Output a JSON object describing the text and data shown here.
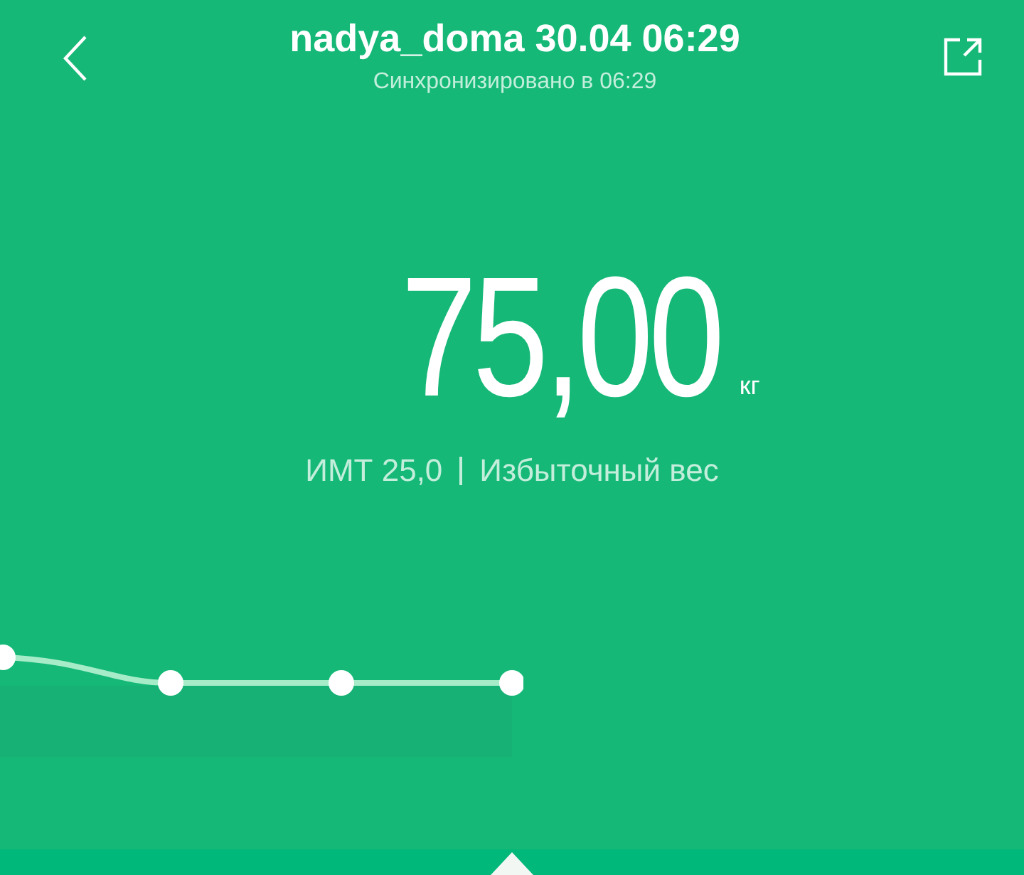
{
  "header": {
    "title": "nadya_doma 30.04 06:29",
    "subtitle": "Синхронизировано в 06:29"
  },
  "weight": {
    "value": "75,00",
    "unit": "кг"
  },
  "bmi": {
    "label": "ИМТ 25,0",
    "status": "Избыточный вес"
  }
}
